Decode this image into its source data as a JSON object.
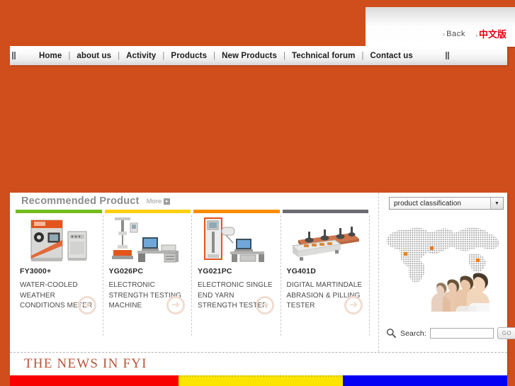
{
  "theme": {
    "background": "#cf4e1b",
    "accent_red": "#e2000f",
    "news_title_color": "#b5553a"
  },
  "header": {
    "back_label": "Back",
    "chinese_label": "中文版",
    "arrow_mark": "›"
  },
  "nav": {
    "items": [
      {
        "label": "Home"
      },
      {
        "label": "about us"
      },
      {
        "label": "Activity"
      },
      {
        "label": "Products"
      },
      {
        "label": "New Products"
      },
      {
        "label": "Technical forum"
      },
      {
        "label": "Contact us"
      }
    ],
    "separator": "|"
  },
  "recommended": {
    "title": "Recommended Product",
    "more_label": "More",
    "more_arrow": "▸"
  },
  "products": [
    {
      "model": "FY3000+",
      "description": "WATER-COOLED WEATHER CONDITIONS METER",
      "bar_color": "#76bc21",
      "arrow": "➜"
    },
    {
      "model": "YG026PC",
      "description": "ELECTRONIC STRENGTH TESTING MACHINE",
      "bar_color": "#fdcf10",
      "arrow": "➜"
    },
    {
      "model": "YG021PC",
      "description": "ELECTRONIC SINGLE END YARN STRENGTH TESTER",
      "bar_color": "#fb8c00",
      "arrow": "➜"
    },
    {
      "model": "YG401D",
      "description": "DIGITAL MARTINDALE ABRASION & PILLING TESTER",
      "bar_color": "#6b6b70",
      "arrow": "➜"
    }
  ],
  "sidebar": {
    "classification_label": "product classification",
    "classification_caret": "▼",
    "search_label": "Search:",
    "search_value": "",
    "search_placeholder": "",
    "go_label": "GO"
  },
  "news": {
    "title": "THE NEWS IN FYI"
  },
  "bottom_strip": {
    "colors": [
      "#f90000",
      "#fbe500",
      "#0400f4"
    ]
  }
}
